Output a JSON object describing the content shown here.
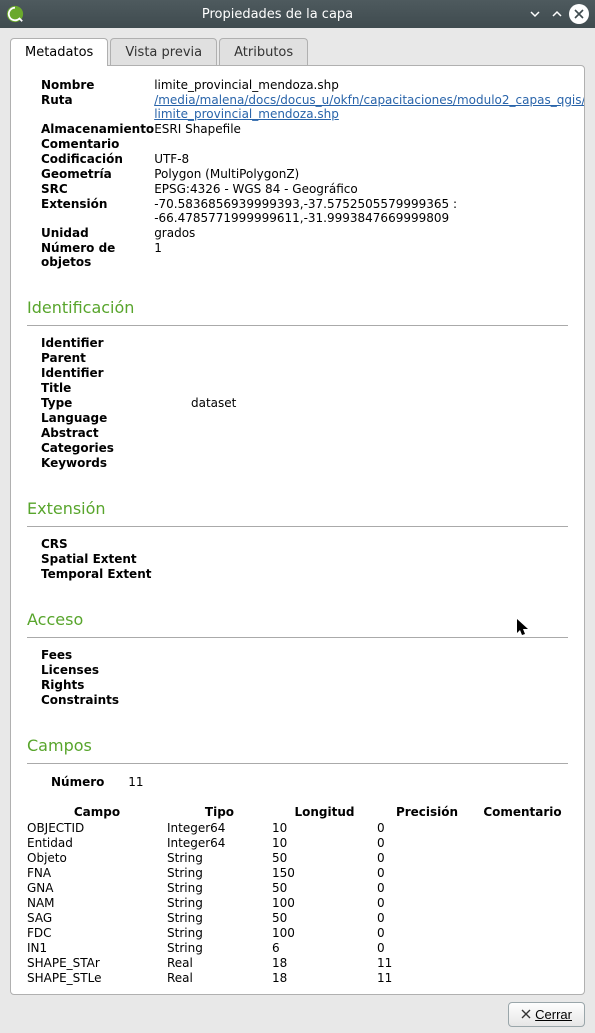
{
  "window": {
    "title": "Propiedades de la capa"
  },
  "tabs": {
    "metadata": "Metadatos",
    "preview": "Vista previa",
    "attributes": "Atributos"
  },
  "info": {
    "labels": {
      "name": "Nombre",
      "path": "Ruta",
      "storage": "Almacenamiento",
      "comment": "Comentario",
      "encoding": "Codificación",
      "geometry": "Geometría",
      "crs": "SRC",
      "extent": "Extensión",
      "unit": "Unidad",
      "featcount": "Número de objetos"
    },
    "values": {
      "name": "limite_provincial_mendoza.shp",
      "path_href": "/media/malena/docs/docus_u/okfn/capacitaciones/modulo2_capas_qgis/limite_provincial_mendoza.shp",
      "path_line1": "/media/malena/docs/docus_u/okfn/capacitaciones/modulo2_capas_qgis/",
      "path_line2": "limite_provincial_mendoza.shp",
      "storage": "ESRI Shapefile",
      "comment": "",
      "encoding": "UTF-8",
      "geometry": "Polygon (MultiPolygonZ)",
      "crs": "EPSG:4326 - WGS 84 - Geográfico",
      "extent_line1": "-70.5836856939999393,-37.5752505579999365 :",
      "extent_line2": "-66.4785771999999611,-31.9993847669999809",
      "unit": "grados",
      "featcount": "1"
    }
  },
  "sections": {
    "ident": "Identificación",
    "extent": "Extensión",
    "access": "Acceso",
    "fields": "Campos"
  },
  "ident": {
    "labels": {
      "identifier": "Identifier",
      "parent": "Parent Identifier",
      "title": "Title",
      "type": "Type",
      "language": "Language",
      "abstract": "Abstract",
      "categories": "Categories",
      "keywords": "Keywords"
    },
    "values": {
      "type": "dataset"
    }
  },
  "extent2": {
    "labels": {
      "crs": "CRS",
      "spatial": "Spatial Extent",
      "temporal": "Temporal Extent"
    }
  },
  "access": {
    "labels": {
      "fees": "Fees",
      "licenses": "Licenses",
      "rights": "Rights",
      "constraints": "Constraints"
    }
  },
  "fieldsmeta": {
    "count_label": "Número",
    "count": "11",
    "headers": {
      "name": "Campo",
      "type": "Tipo",
      "length": "Longitud",
      "prec": "Precisión",
      "comment": "Comentario"
    },
    "rows": [
      {
        "name": "OBJECTID",
        "type": "Integer64",
        "length": "10",
        "prec": "0"
      },
      {
        "name": "Entidad",
        "type": "Integer64",
        "length": "10",
        "prec": "0"
      },
      {
        "name": "Objeto",
        "type": "String",
        "length": "50",
        "prec": "0"
      },
      {
        "name": "FNA",
        "type": "String",
        "length": "150",
        "prec": "0"
      },
      {
        "name": "GNA",
        "type": "String",
        "length": "50",
        "prec": "0"
      },
      {
        "name": "NAM",
        "type": "String",
        "length": "100",
        "prec": "0"
      },
      {
        "name": "SAG",
        "type": "String",
        "length": "50",
        "prec": "0"
      },
      {
        "name": "FDC",
        "type": "String",
        "length": "100",
        "prec": "0"
      },
      {
        "name": "IN1",
        "type": "String",
        "length": "6",
        "prec": "0"
      },
      {
        "name": "SHAPE_STAr",
        "type": "Real",
        "length": "18",
        "prec": "11"
      },
      {
        "name": "SHAPE_STLe",
        "type": "Real",
        "length": "18",
        "prec": "11"
      }
    ]
  },
  "footer": {
    "close": "Cerrar"
  }
}
